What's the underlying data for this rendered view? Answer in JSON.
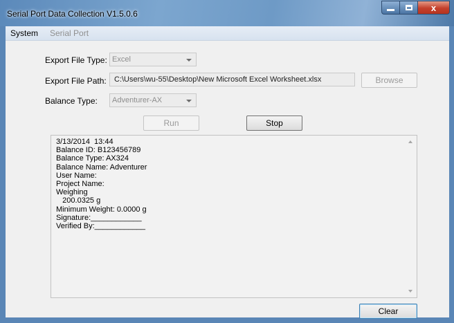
{
  "window": {
    "title": "Serial Port Data Collection  V1.5.0.6",
    "close_glyph": "x"
  },
  "menu": {
    "system": "System",
    "serial_port": "Serial Port"
  },
  "form": {
    "export_file_type_label": "Export File Type:",
    "export_file_type_value": "Excel",
    "export_file_path_label": "Export File Path:",
    "export_file_path_value": "C:\\Users\\wu-55\\Desktop\\New Microsoft Excel Worksheet.xlsx",
    "browse_label": "Browse",
    "balance_type_label": "Balance Type:",
    "balance_type_value": "Adventurer-AX"
  },
  "actions": {
    "run_label": "Run",
    "stop_label": "Stop",
    "clear_label": "Clear"
  },
  "log": {
    "text": "3/13/2014  13:44\nBalance ID: B123456789\nBalance Type: AX324\nBalance Name: Adventurer\nUser Name:\nProject Name:\nWeighing\n   200.0325 g\nMinimum Weight: 0.0000 g\nSignature:____________\nVerified By:____________"
  }
}
